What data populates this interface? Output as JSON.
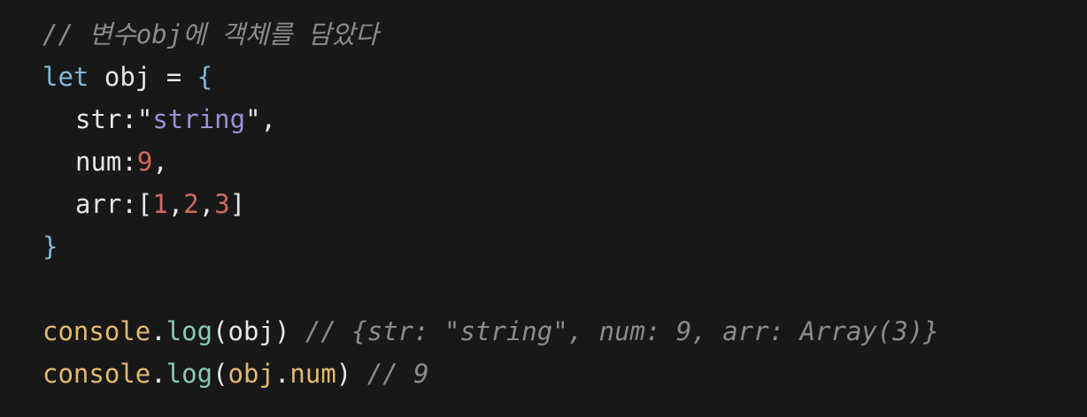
{
  "code": {
    "comment_header": "// 변수obj에 객체를 담았다",
    "kw_let": "let",
    "var_obj": "obj",
    "op_assign": "=",
    "brace_open": "{",
    "key_str": "str:",
    "quote_open": "\"",
    "val_string": "string",
    "quote_close": "\"",
    "comma": ",",
    "key_num": "num:",
    "val_nine": "9",
    "key_arr": "arr:[",
    "arr_1": "1",
    "arr_2": "2",
    "arr_3": "3",
    "arr_close": "]",
    "brace_close": "}",
    "console": "console",
    "dot": ".",
    "log": "log",
    "paren_open": "(",
    "paren_close": ")",
    "arg_obj": "obj",
    "arg_obj2": "obj",
    "arg_num": "num",
    "comment_line8": "// {str: \"string\", num: 9, arr: Array(3)}",
    "comment_line9": "// 9"
  },
  "colors": {
    "background": "#181818",
    "comment": "#8b8b8b",
    "keyword": "#7fb8d9",
    "string": "#9c8fd8",
    "number": "#d06a5f",
    "function": "#e3b96e",
    "method": "#8cc9b5",
    "text": "#e7e7e7"
  }
}
